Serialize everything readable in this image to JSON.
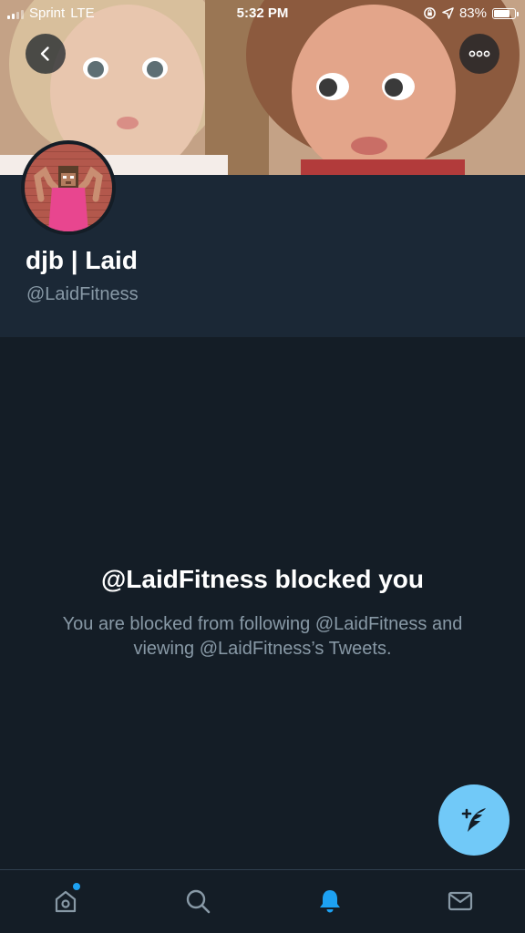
{
  "status_bar": {
    "carrier": "Sprint",
    "network": "LTE",
    "time": "5:32 PM",
    "battery_percent": "83%",
    "battery_level": 0.83
  },
  "profile": {
    "display_name": "djb | Laid",
    "handle": "@LaidFitness"
  },
  "blocked": {
    "title": "@LaidFitness blocked you",
    "message": "You are blocked from following @LaidFitness and viewing @LaidFitness’s Tweets."
  },
  "icons": {
    "back": "chevron-left-icon",
    "more": "more-horizontal-icon",
    "compose": "compose-tweet-icon",
    "home": "home-icon",
    "search": "search-icon",
    "notifications": "bell-icon",
    "messages": "envelope-icon"
  },
  "colors": {
    "background": "#141d26",
    "profile_panel": "#1b2836",
    "accent": "#1da1f2",
    "fab": "#71c9f8",
    "secondary_text": "#8899a6"
  },
  "tabs": {
    "active": "notifications",
    "home_has_badge": true
  }
}
